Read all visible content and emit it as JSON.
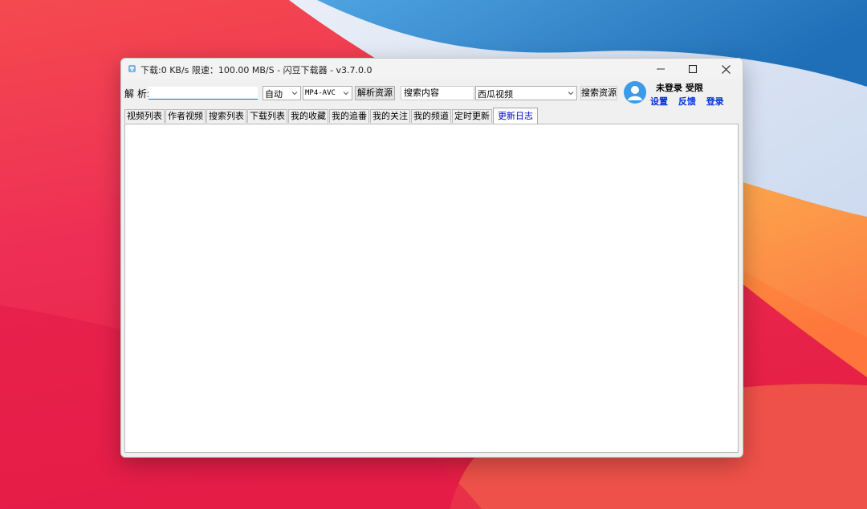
{
  "window": {
    "title": "下载:0 KB/s  限速：100.00 MB/S  - 闪豆下载器 - v3.7.0.0"
  },
  "toolbar": {
    "parse_label": "解 析:",
    "url_value": "",
    "auto_select": "自动",
    "format_select": "MP4-AVC",
    "parse_button": "解析资源",
    "search_input": "搜索内容",
    "site_select": "西瓜视频",
    "search_button": "搜索资源"
  },
  "user": {
    "status": "未登录  受限",
    "settings": "设置",
    "feedback": "反馈",
    "login": "登录"
  },
  "tabs": [
    {
      "label": "视频列表"
    },
    {
      "label": "作者视频"
    },
    {
      "label": "搜索列表"
    },
    {
      "label": "下载列表"
    },
    {
      "label": "我的收藏"
    },
    {
      "label": "我的追番"
    },
    {
      "label": "我的关注"
    },
    {
      "label": "我的频道"
    },
    {
      "label": "定时更新"
    },
    {
      "label": "更新日志",
      "active": true
    }
  ],
  "colors": {
    "accent": "#0078d7",
    "link": "#0033dd",
    "active_tab": "#0000cc",
    "avatar": "#3b9be8"
  },
  "icons": [
    "app-icon",
    "minimize-icon",
    "maximize-icon",
    "close-icon",
    "chevron-down-icon",
    "user-avatar-icon"
  ]
}
